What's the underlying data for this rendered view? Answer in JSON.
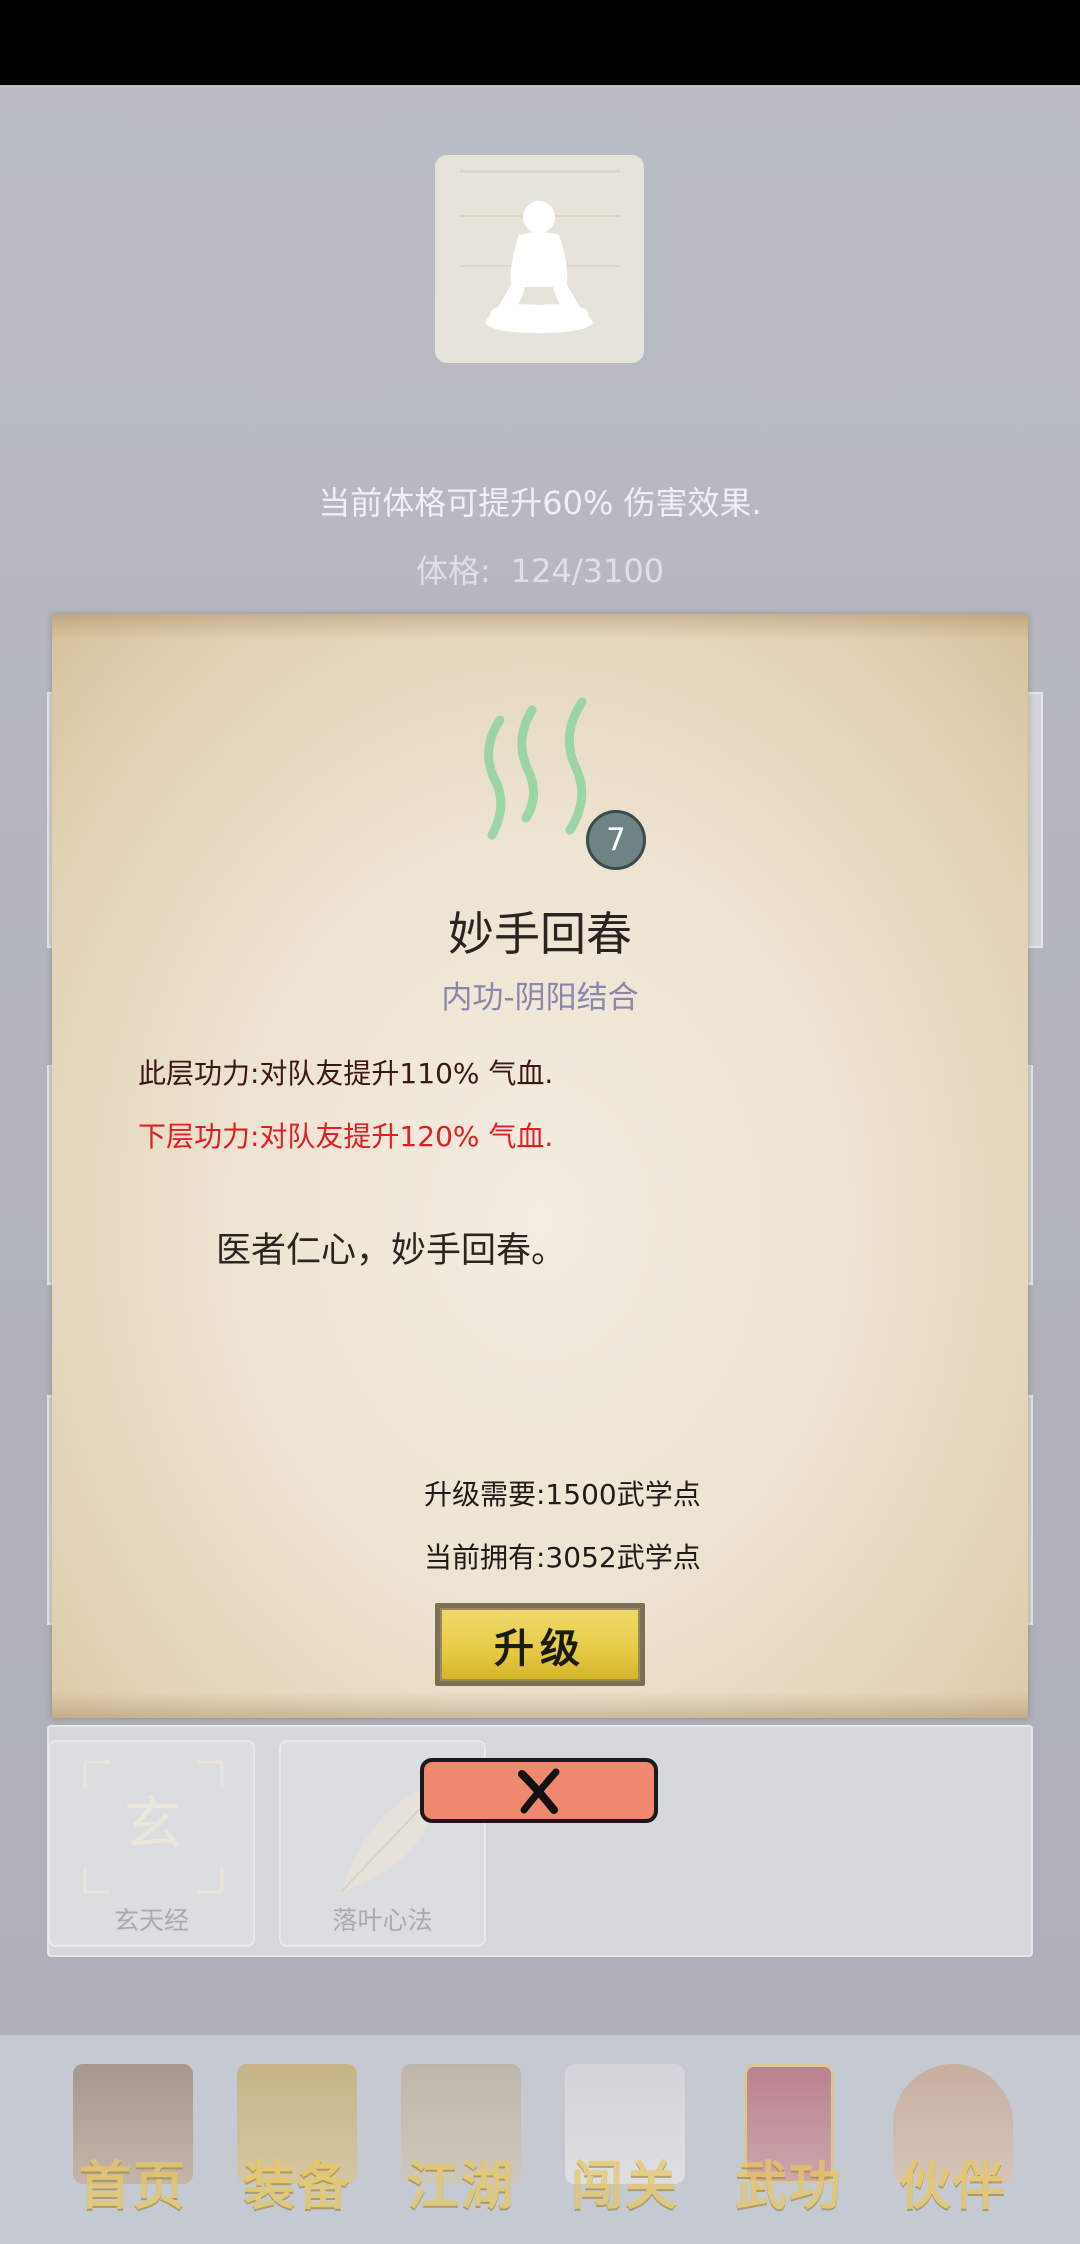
{
  "header": {
    "effect_text": "当前体格可提升60% 伤害效果.",
    "stat_label": "体格:",
    "stat_value": "124/3100"
  },
  "skill": {
    "level": "7",
    "name": "妙手回春",
    "type": "内功-阴阳结合",
    "current_effect": "此层功力:对队友提升110% 气血.",
    "next_effect": "下层功力:对队友提升120% 气血.",
    "quote": "医者仁心，妙手回春。",
    "upgrade_cost": "升级需要:1500武学点",
    "current_points": "当前拥有:3052武学点",
    "upgrade_label": "升级",
    "colors": {
      "next_effect": "#e01e24",
      "type": "#8a86ae",
      "badge": "#6d8384"
    }
  },
  "background_list": {
    "cards": [
      {
        "label": "玄天经",
        "icon": "xuan-character-icon"
      },
      {
        "label": "落叶心法",
        "icon": "leaf-icon"
      }
    ]
  },
  "bottom_nav": {
    "items": [
      {
        "label": "首页",
        "icon": "house-icon"
      },
      {
        "label": "装备",
        "icon": "armor-icon"
      },
      {
        "label": "江湖",
        "icon": "scroll-map-icon"
      },
      {
        "label": "闯关",
        "icon": "crossed-swords-icon"
      },
      {
        "label": "武功",
        "icon": "book-icon"
      },
      {
        "label": "伙伴",
        "icon": "partners-icon"
      }
    ]
  }
}
